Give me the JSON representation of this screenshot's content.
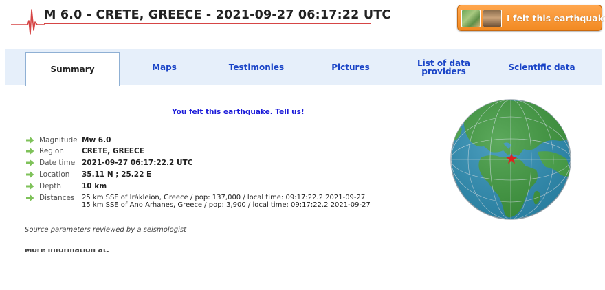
{
  "header": {
    "title": "M 6.0 - CRETE, GREECE - 2021-09-27 06:17:22 UTC",
    "felt_button_label": "I felt this earthquake",
    "seismogram_icon": "seismogram-icon",
    "accent_color": "#d64545"
  },
  "tabs": [
    {
      "label": "Summary",
      "active": true
    },
    {
      "label": "Maps",
      "active": false
    },
    {
      "label": "Testimonies",
      "active": false
    },
    {
      "label": "Pictures",
      "active": false
    },
    {
      "label": "List of data providers",
      "active": false
    },
    {
      "label": "Scientific data",
      "active": false
    }
  ],
  "summary": {
    "felt_link": "You felt this earthquake. Tell us!",
    "params": [
      {
        "label": "Magnitude",
        "value": "Mw 6.0"
      },
      {
        "label": "Region",
        "value": "CRETE, GREECE"
      },
      {
        "label": "Date time",
        "value": "2021-09-27 06:17:22.2 UTC"
      },
      {
        "label": "Location",
        "value": "35.11 N ; 25.22 E"
      },
      {
        "label": "Depth",
        "value": "10 km"
      },
      {
        "label": "Distances",
        "value_lines": [
          "25 km SSE of Irákleion, Greece / pop: 137,000 / local time: 09:17:22.2 2021-09-27",
          "15 km SSE of Ano Arhanes, Greece / pop: 3,900 / local time: 09:17:22.2 2021-09-27"
        ]
      }
    ],
    "source_note": "Source parameters reviewed by a seismologist",
    "more_info": "More information at:"
  },
  "globe": {
    "icon": "globe-map-icon",
    "epicenter_marker": "star-icon",
    "ocean_color": "#2e8fb5",
    "land_color": "#3f9a3f"
  }
}
